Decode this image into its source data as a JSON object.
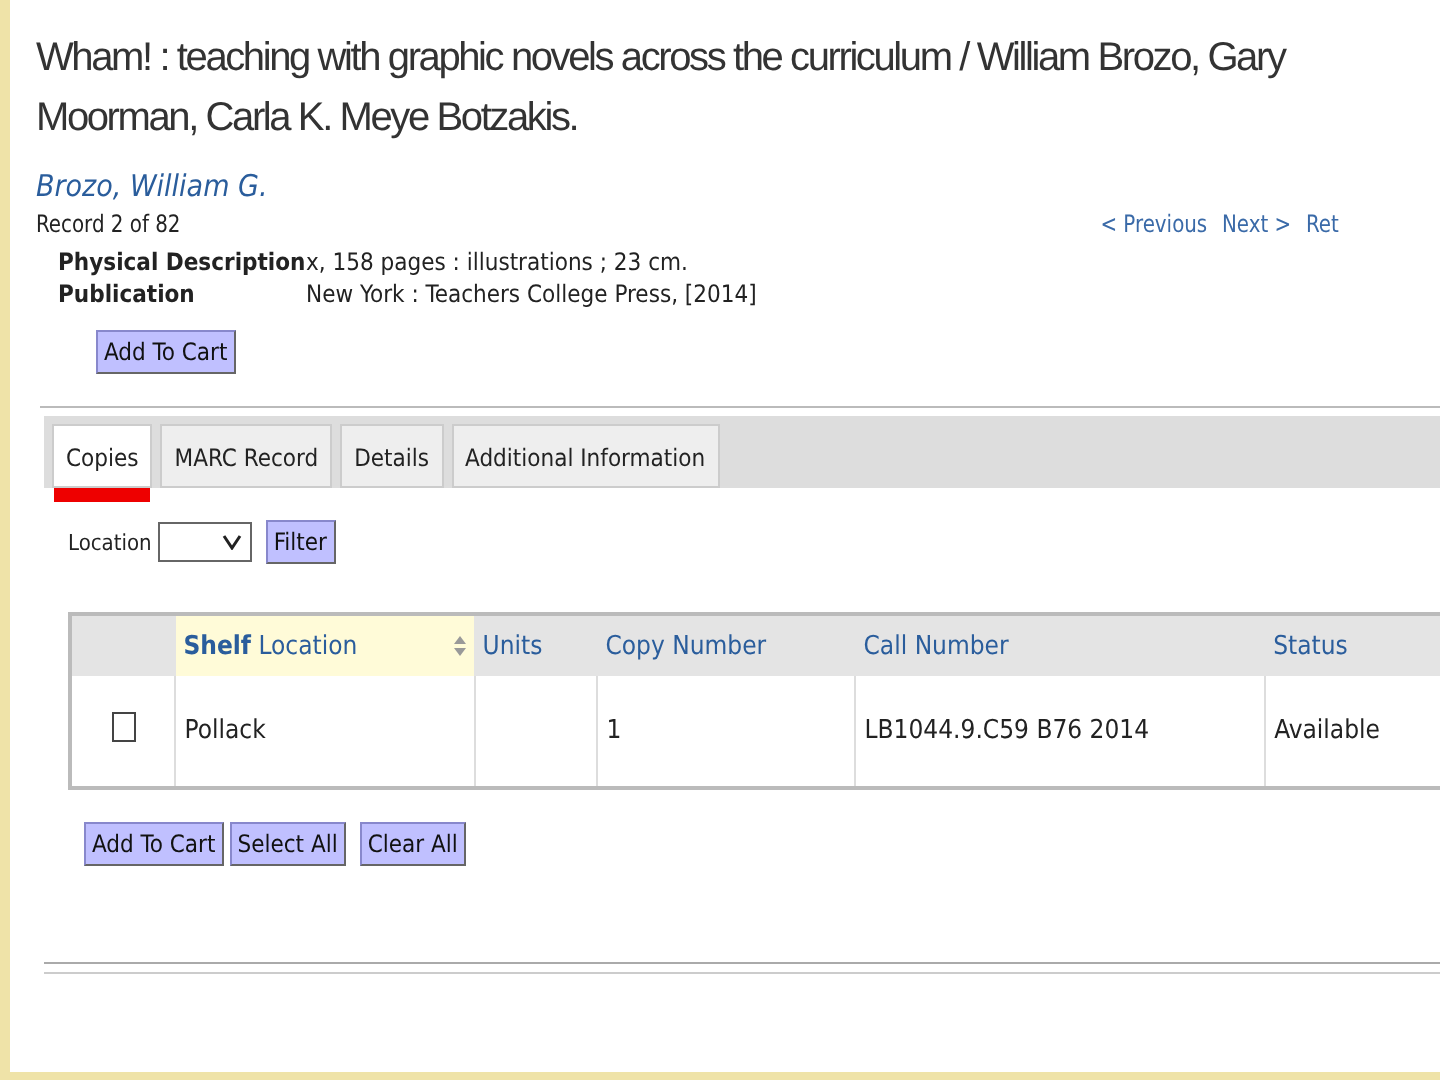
{
  "record": {
    "title": "Wham! : teaching with graphic novels across the curriculum / William Brozo, Gary Moorman, Carla K. Meye Botzakis.",
    "author": "Brozo, William G.",
    "position": "Record 2 of 82",
    "nav": [
      "< Previous",
      "Next >",
      "Ret"
    ]
  },
  "fields": [
    {
      "label": "Physical Description",
      "value": "x, 158 pages : illustrations ; 23 cm."
    },
    {
      "label": "Publication",
      "value": "New York : Teachers College Press, [2014]"
    }
  ],
  "add_button": "Add To Cart",
  "tabs": [
    {
      "label": "Copies",
      "selected": true
    },
    {
      "label": "MARC Record",
      "selected": false
    },
    {
      "label": "Details",
      "selected": false
    },
    {
      "label": "Additional Information",
      "selected": false
    }
  ],
  "filter": {
    "label": "Location",
    "button": "Filter"
  },
  "table": {
    "columns": [
      "**Shelf** Location",
      "Units",
      "Copy Number",
      "Call Number",
      "Status"
    ],
    "rows": [
      {
        "checked": false,
        "cells": [
          "Pollack",
          "",
          "1",
          "LB1044.9.C59 B76 2014",
          "Available"
        ]
      }
    ]
  },
  "actions": [
    "Add To Cart",
    "Select All",
    "Clear All"
  ]
}
